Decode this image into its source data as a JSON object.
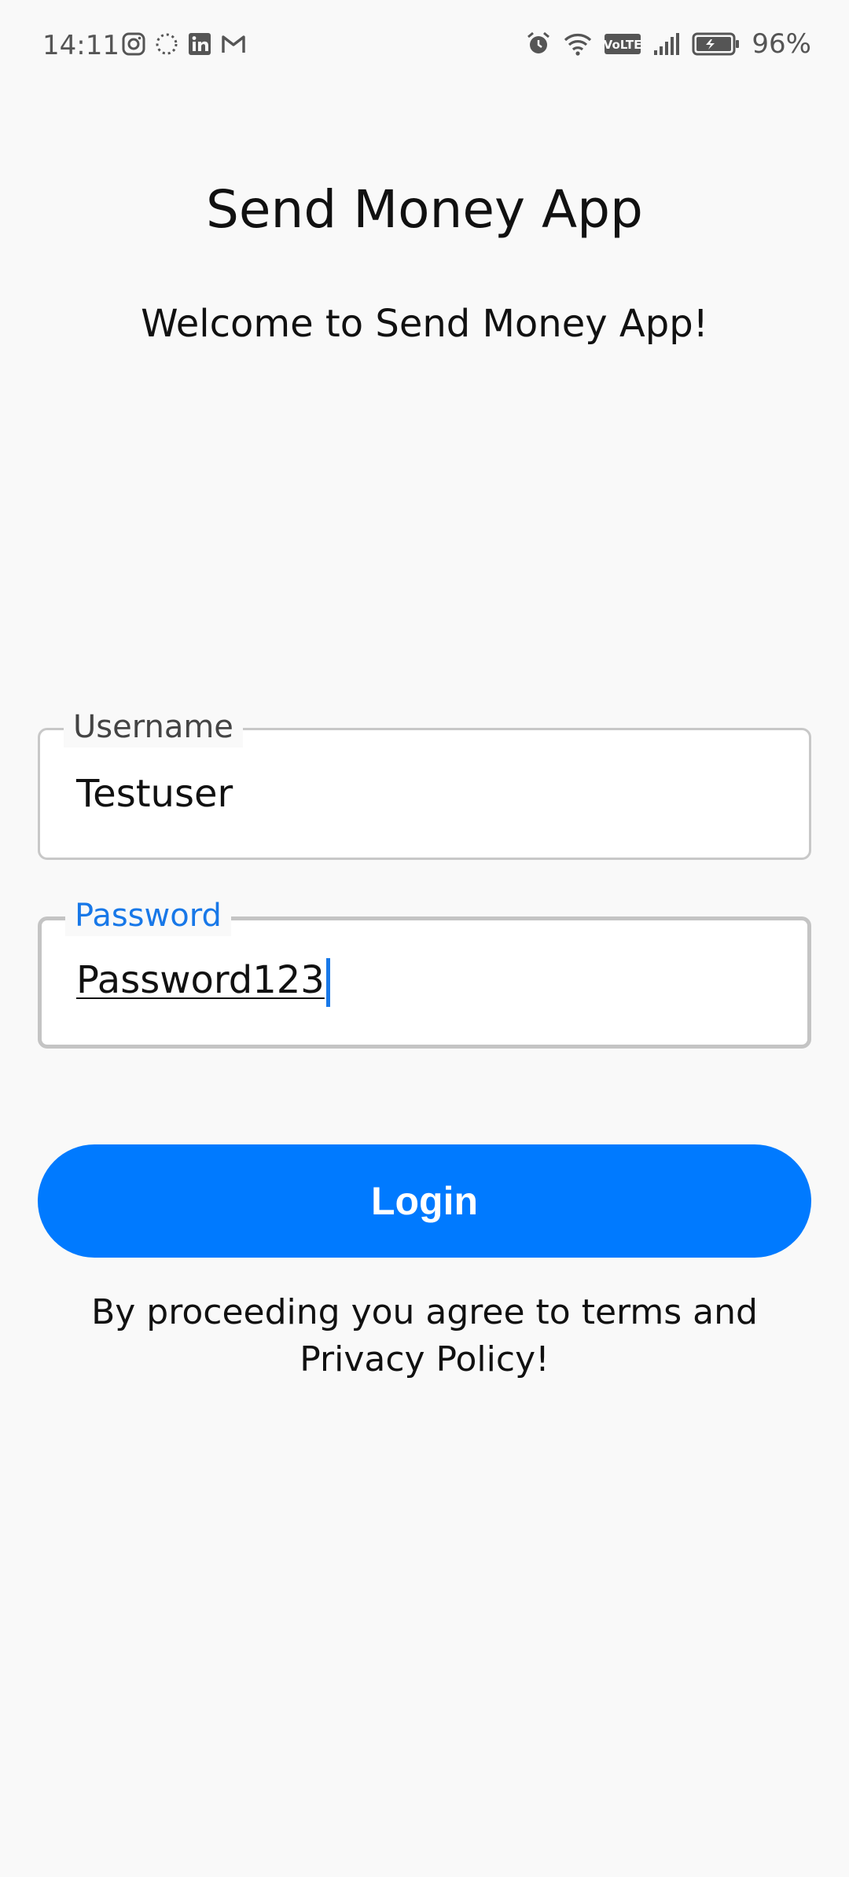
{
  "status_bar": {
    "time": "14:11",
    "battery": "96%",
    "left_icons": [
      "instagram-icon",
      "loading-circle-icon",
      "linkedin-icon",
      "gmail-icon"
    ],
    "right_icons": [
      "alarm-icon",
      "wifi-icon",
      "volte-icon",
      "signal-icon",
      "battery-icon"
    ]
  },
  "header": {
    "title": "Send Money App",
    "welcome": "Welcome to Send Money App!"
  },
  "form": {
    "username": {
      "label": "Username",
      "value": "Testuser"
    },
    "password": {
      "label": "Password",
      "value": "Password123"
    },
    "login_label": "Login"
  },
  "footer": {
    "terms": "By proceeding you agree to terms and Privacy Policy!"
  },
  "colors": {
    "accent": "#007aff",
    "focus_label": "#1878e8",
    "background": "#f9f9f9"
  }
}
